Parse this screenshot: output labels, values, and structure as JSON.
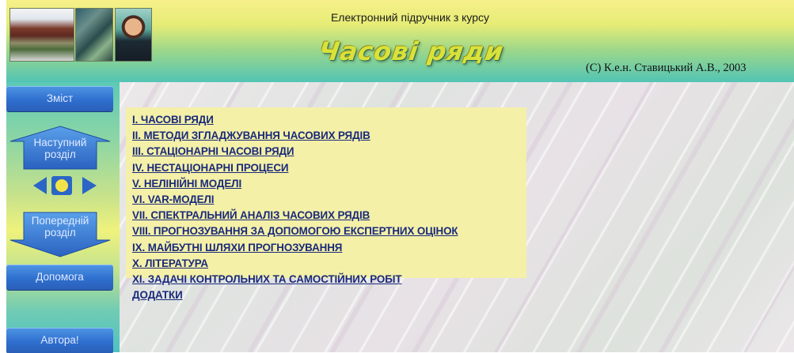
{
  "header": {
    "top_title": "Електронний підручник з курсу",
    "logo_title": "Часові ряди",
    "copyright": "(С) К.е.н. Ставицький А.В., 2003"
  },
  "nav": {
    "contents_label": "Зміст",
    "next_label": "Наступний розділ",
    "next_lines": [
      "Наступний",
      "розділ"
    ],
    "prev_lines": [
      "Попередній",
      "розділ"
    ],
    "help_label": "Допомога",
    "authors_label": "Автора!"
  },
  "toc": {
    "items": [
      "I. ЧАСОВІ РЯДИ",
      "II. МЕТОДИ ЗГЛАДЖУВАННЯ ЧАСОВИХ РЯДІВ",
      "III. СТАЦІОНАРНІ ЧАСОВІ РЯДИ",
      "IV. НЕСТАЦІОНАРНІ ПРОЦЕСИ",
      "V. НЕЛІНІЙНІ МОДЕЛІ",
      "VI. VAR-МОДЕЛІ",
      "VII. СПЕКТРАЛЬНИЙ АНАЛІЗ ЧАСОВИХ РЯДІВ",
      "VIII. ПРОГНОЗУВАННЯ ЗА ДОПОМОГОЮ ЕКСПЕРТНИХ ОЦІНОК",
      "IX. МАЙБУТНІ ШЛЯХИ ПРОГНОЗУВАННЯ",
      "X. ЛІТЕРАТУРА",
      "XI. ЗАДАЧІ КОНТРОЛЬНИХ ТА САМОСТІЙНИХ РОБІТ",
      "ДОДАТКИ"
    ]
  },
  "colors": {
    "nav_button": "#2f6fcf",
    "toc_background": "#f4f0a8",
    "link": "#1a2a7a",
    "pager_dot": "#f3e34a"
  }
}
